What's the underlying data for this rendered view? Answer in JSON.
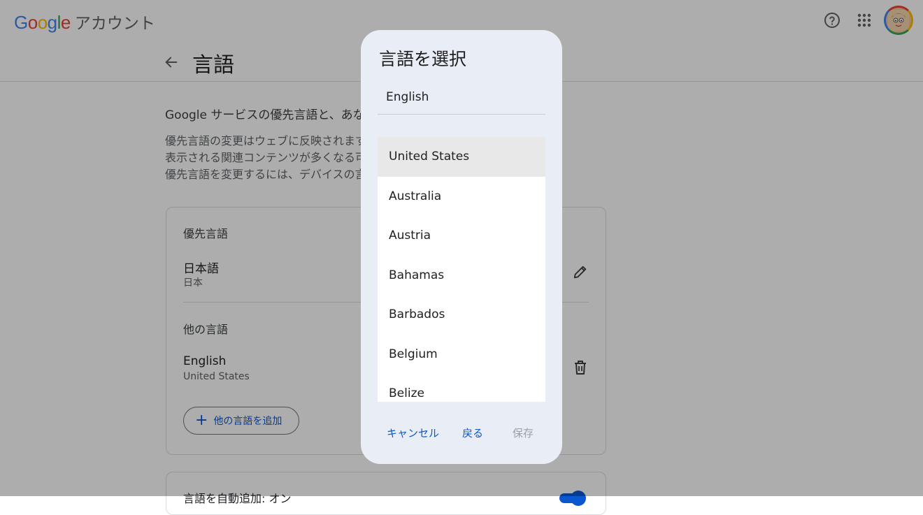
{
  "header": {
    "logo_text": "Google",
    "account_label": "アカウント",
    "help_icon": "help-circle-icon",
    "apps_icon": "apps-grid-icon",
    "avatar_icon": "account-avatar-icon"
  },
  "page": {
    "title": "言語",
    "intro": "Google サービスの優先言語と、あなた",
    "desc_lines": [
      "優先言語の変更はウェブに反映されます",
      "表示される関連コンテンツが多くなる可",
      "優先言語を変更するには、デバイスの言"
    ]
  },
  "preferred": {
    "heading": "優先言語",
    "lang": "日本語",
    "region": "日本",
    "edit_icon": "pencil-icon"
  },
  "other": {
    "heading": "他の言語",
    "lang": "English",
    "region": "United States",
    "delete_icon": "trash-icon",
    "add_label": "他の言語を追加"
  },
  "auto_add": {
    "label": "言語を自動追加: オン"
  },
  "dialog": {
    "title": "言語を選択",
    "field_value": "English",
    "options": [
      "United States",
      "Australia",
      "Austria",
      "Bahamas",
      "Barbados",
      "Belgium",
      "Belize"
    ],
    "selected_index": 0,
    "cancel_label": "キャンセル",
    "back_label": "戻る",
    "save_label": "保存"
  },
  "colors": {
    "accent": "#0b57d0",
    "dialog_bg": "#e9eef6",
    "disabled_text": "#9aa0a6"
  }
}
